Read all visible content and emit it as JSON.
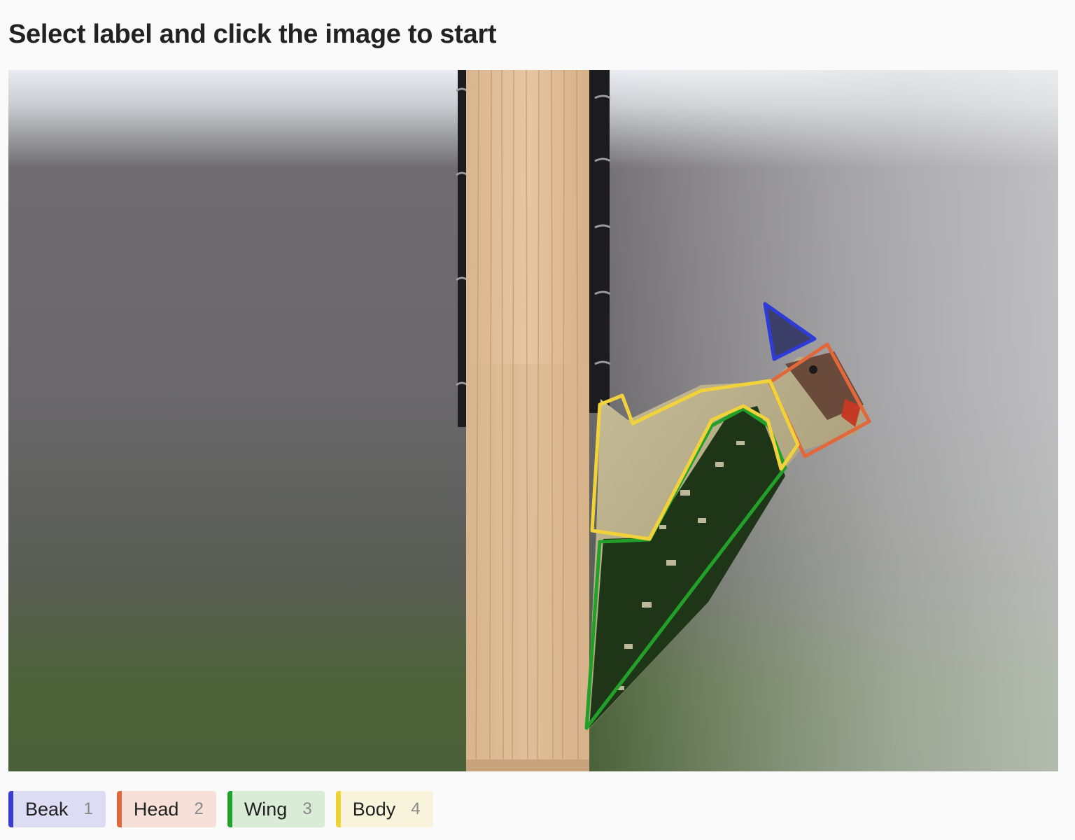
{
  "heading": "Select label and click the image to start",
  "labels": [
    {
      "name": "Beak",
      "hotkey": "1",
      "color": "#3b3bd6",
      "bg": "#dcdcf5"
    },
    {
      "name": "Head",
      "hotkey": "2",
      "color": "#e0673a",
      "bg": "#f6e0d8"
    },
    {
      "name": "Wing",
      "hotkey": "3",
      "color": "#24a12a",
      "bg": "#d9ecd6"
    },
    {
      "name": "Body",
      "hotkey": "4",
      "color": "#f0d232",
      "bg": "#f8f4dc"
    }
  ],
  "image": {
    "subject": "woodpecker-on-wooden-post",
    "annotation_colors": {
      "beak": "#2f3bd9",
      "head": "#e2673a",
      "wing": "#22a02a",
      "body": "#f2d23a"
    }
  }
}
